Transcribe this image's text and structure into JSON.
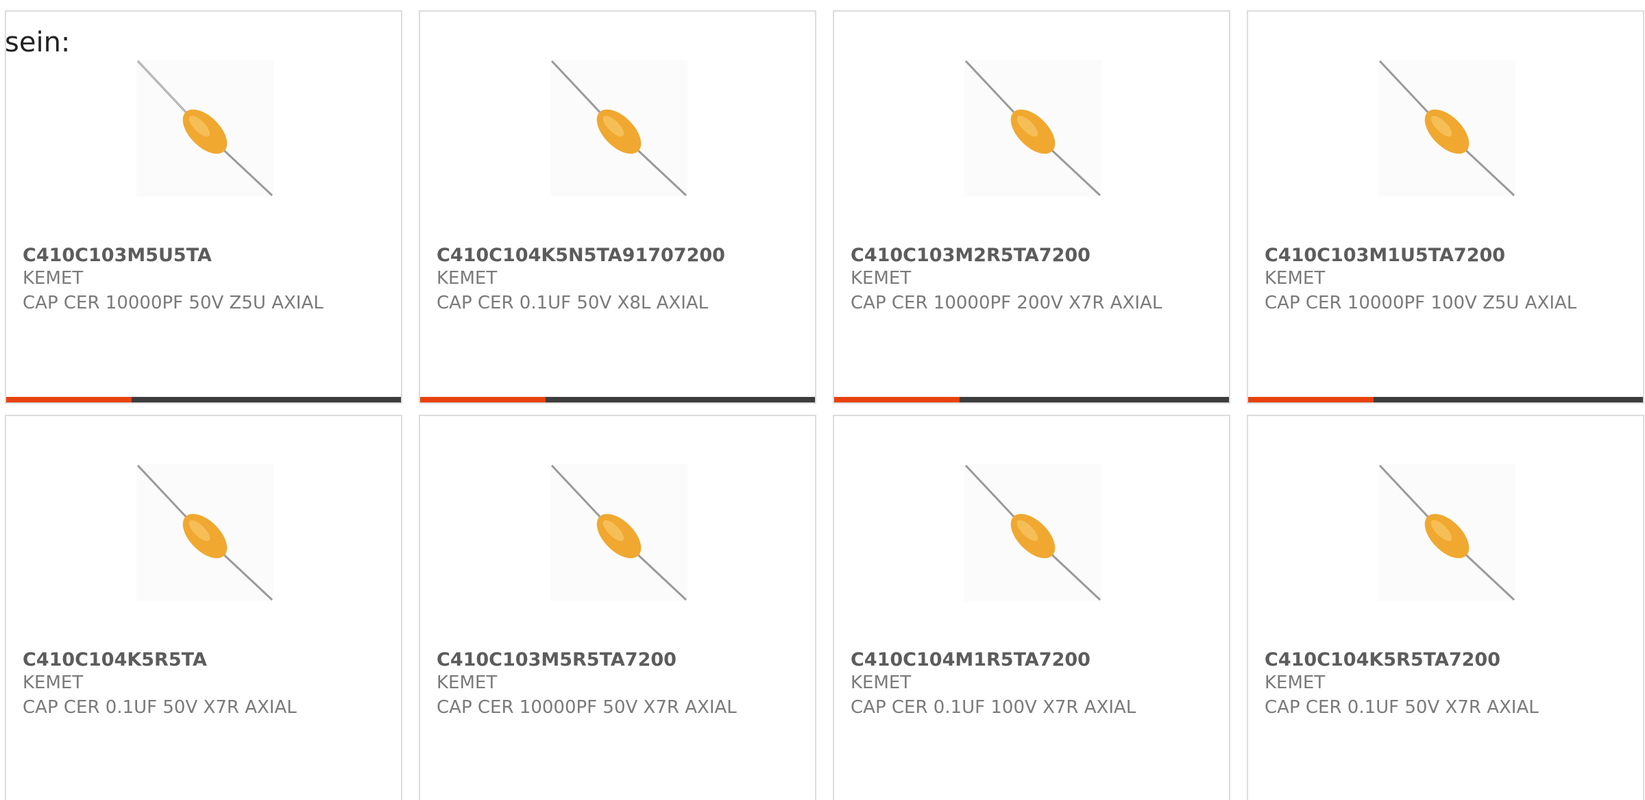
{
  "intro_text": "sein:",
  "colors": {
    "accent": "#e8420c",
    "bar": "#3d3d3d",
    "capacitor_body": "#f0a830"
  },
  "product_image_icon": "axial-capacitor-icon",
  "products": [
    {
      "part_number": "C410C103M5U5TA",
      "manufacturer": "KEMET",
      "description": "CAP CER 10000PF 50V Z5U AXIAL",
      "show_bar": true
    },
    {
      "part_number": "C410C104K5N5TA91707200",
      "manufacturer": "KEMET",
      "description": "CAP CER 0.1UF 50V X8L AXIAL",
      "show_bar": true
    },
    {
      "part_number": "C410C103M2R5TA7200",
      "manufacturer": "KEMET",
      "description": "CAP CER 10000PF 200V X7R AXIAL",
      "show_bar": true
    },
    {
      "part_number": "C410C103M1U5TA7200",
      "manufacturer": "KEMET",
      "description": "CAP CER 10000PF 100V Z5U AXIAL",
      "show_bar": true
    },
    {
      "part_number": "C410C104K5R5TA",
      "manufacturer": "KEMET",
      "description": "CAP CER 0.1UF 50V X7R AXIAL",
      "show_bar": false
    },
    {
      "part_number": "C410C103M5R5TA7200",
      "manufacturer": "KEMET",
      "description": "CAP CER 10000PF 50V X7R AXIAL",
      "show_bar": false
    },
    {
      "part_number": "C410C104M1R5TA7200",
      "manufacturer": "KEMET",
      "description": "CAP CER 0.1UF 100V X7R AXIAL",
      "show_bar": false
    },
    {
      "part_number": "C410C104K5R5TA7200",
      "manufacturer": "KEMET",
      "description": "CAP CER 0.1UF 50V X7R AXIAL",
      "show_bar": false
    }
  ]
}
